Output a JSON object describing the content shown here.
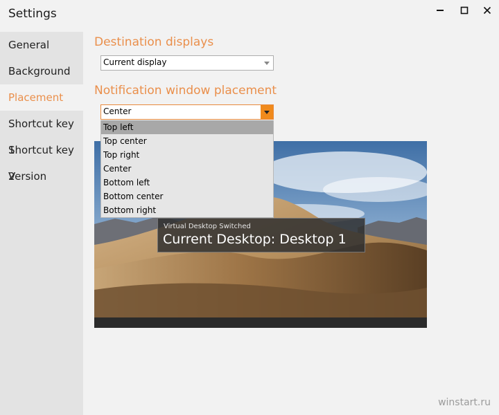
{
  "window": {
    "title": "Settings"
  },
  "sidebar": {
    "items": [
      {
        "label": "General"
      },
      {
        "label": "Background"
      },
      {
        "label": "Placement",
        "selected": true
      },
      {
        "label": "Shortcut key 1"
      },
      {
        "label": "Shortcut key 2"
      },
      {
        "label": "Version"
      }
    ]
  },
  "destination": {
    "title": "Destination displays",
    "selected": "Current display"
  },
  "placement": {
    "title": "Notification window placement",
    "selected": "Center",
    "options": [
      "Top left",
      "Top center",
      "Top right",
      "Center",
      "Bottom left",
      "Bottom center",
      "Bottom right"
    ],
    "hovered_option": "Top left"
  },
  "notification": {
    "caption": "Virtual Desktop Switched",
    "text": "Current Desktop: Desktop 1"
  },
  "watermark": "winstart.ru",
  "colors": {
    "accent": "#ea8f4b",
    "dropdown_arrow_bg": "#f08a1c",
    "sidebar_bg": "#e3e3e3"
  },
  "icons": {
    "minimize": "minimize-icon",
    "maximize": "maximize-icon",
    "close": "close-icon",
    "dropdown": "chevron-down-icon"
  }
}
